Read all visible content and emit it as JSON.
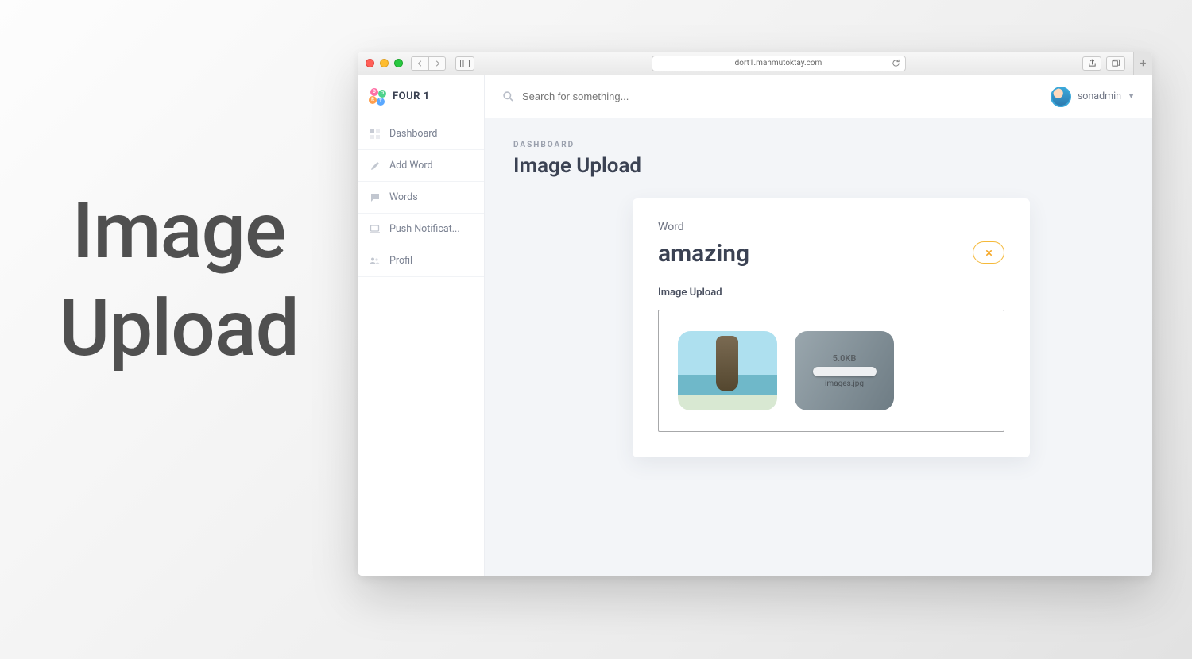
{
  "exterior_label": "Image\nUpload",
  "browser": {
    "url": "dort1.mahmutoktay.com"
  },
  "brand": {
    "name": "FOUR 1"
  },
  "sidebar": {
    "items": [
      {
        "label": "Dashboard"
      },
      {
        "label": "Add Word"
      },
      {
        "label": "Words"
      },
      {
        "label": "Push Notificat..."
      },
      {
        "label": "Profil"
      }
    ]
  },
  "topbar": {
    "search_placeholder": "Search for something...",
    "username": "sonadmin"
  },
  "page": {
    "breadcrumb": "DASHBOARD",
    "title": "Image Upload"
  },
  "card": {
    "word_label": "Word",
    "word_value": "amazing",
    "section_label": "Image Upload",
    "upload": {
      "file_size": "5.0KB",
      "file_name": "images.jpg"
    }
  }
}
